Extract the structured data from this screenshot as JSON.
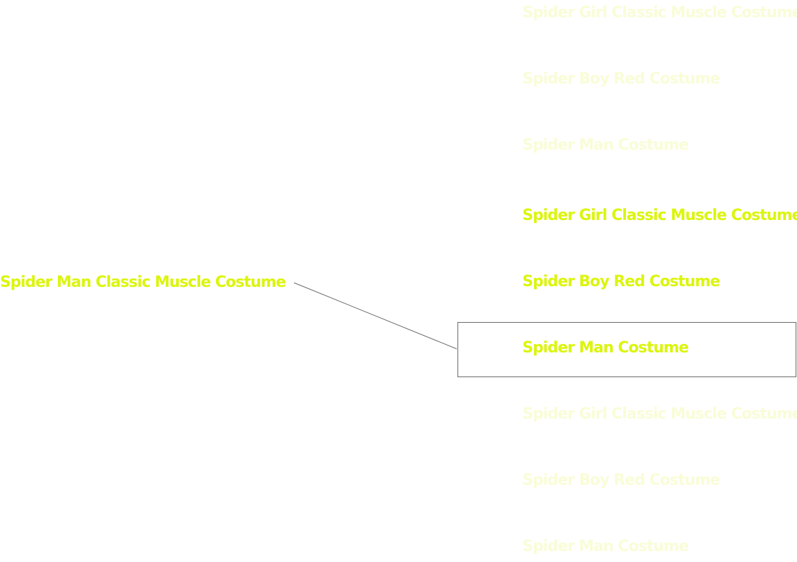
{
  "source": {
    "label": "Spider Man Classic Muscle Costume"
  },
  "options": [
    {
      "label": "Spider Girl Classic Muscle Costume",
      "faded": true
    },
    {
      "label": "Spider Boy Red Costume",
      "faded": true
    },
    {
      "label": "Spider Man Costume",
      "faded": true
    },
    {
      "label": "Spider Girl Classic Muscle Costume",
      "faded": false
    },
    {
      "label": "Spider Boy Red Costume",
      "faded": false
    },
    {
      "label": "Spider Man Costume",
      "faded": false,
      "selected": true
    },
    {
      "label": "Spider Girl Classic Muscle Costume",
      "faded": true
    },
    {
      "label": "Spider Boy Red Costume",
      "faded": true
    },
    {
      "label": "Spider Man Costume",
      "faded": true
    }
  ],
  "colors": {
    "label": "#dbf50d",
    "connector": "#666666",
    "selection_border": "#666666",
    "background": "#ffffff"
  }
}
